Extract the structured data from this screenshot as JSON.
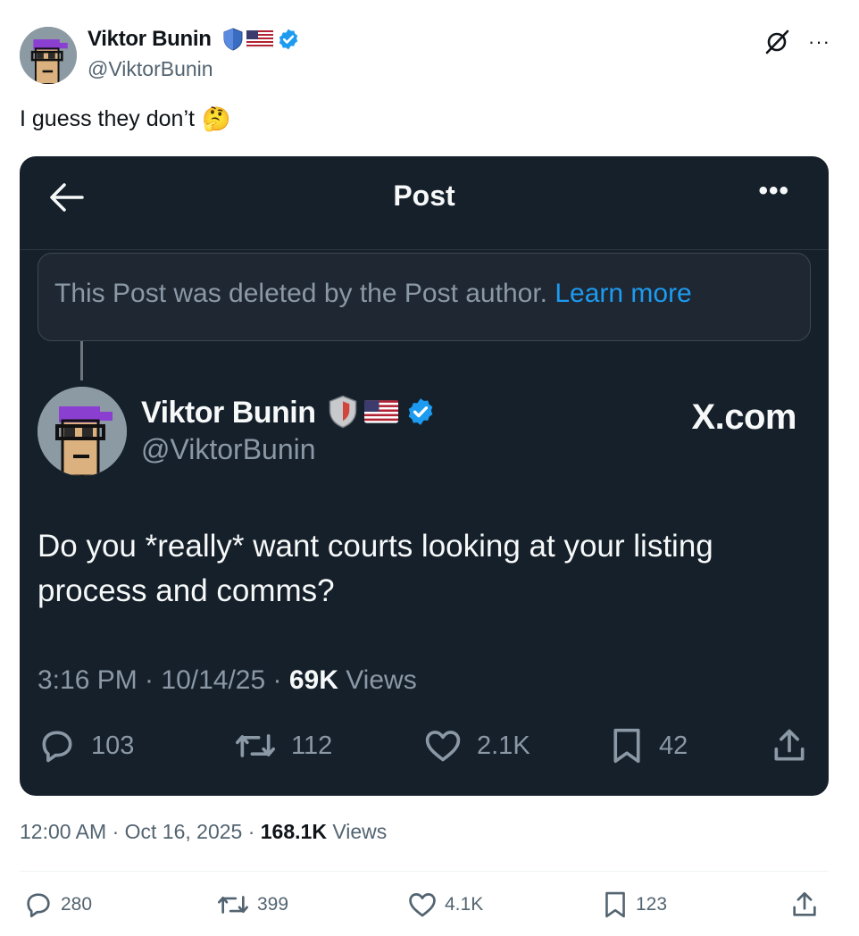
{
  "post": {
    "author_name": "Viktor Bunin",
    "author_handle": "@ViktorBunin",
    "text": "I guess they don’t",
    "emoji": "🤔",
    "timestamp": "12:00 AM · Oct 16, 2025 · ",
    "views_count": "168.1K",
    "views_label": " Views",
    "more_label": "···",
    "actions": {
      "replies": "280",
      "reposts": "399",
      "likes": "4.1K",
      "bookmarks": "123"
    }
  },
  "quoted_screenshot": {
    "header_title": "Post",
    "more_label": "•••",
    "deleted_notice": "This Post was deleted by the Post author.",
    "learn_more": "Learn more",
    "author_name": "Viktor Bunin",
    "author_handle": "@ViktorBunin",
    "watermark": "X.com",
    "text": "Do you *really* want courts looking at your listing process and comms?",
    "meta_prefix": "3:16 PM · 10/14/25 · ",
    "views_count": "69K",
    "views_label": " Views",
    "actions": {
      "replies": "103",
      "reposts": "112",
      "likes": "2.1K",
      "bookmarks": "42"
    }
  },
  "colors": {
    "verified": "#1d9bf0",
    "card_bg": "#15202b",
    "muted_light": "#536471",
    "muted_dark": "#8b98a5",
    "avatar_hat": "#8a3fd1",
    "avatar_bg": "#8c9aa3",
    "avatar_skin": "#dbb180"
  },
  "icons": [
    "shield-icon",
    "us-flag-icon",
    "verified-badge-icon",
    "grok-icon",
    "back-arrow-icon",
    "reply-icon",
    "repost-icon",
    "like-icon",
    "bookmark-icon",
    "share-icon"
  ]
}
